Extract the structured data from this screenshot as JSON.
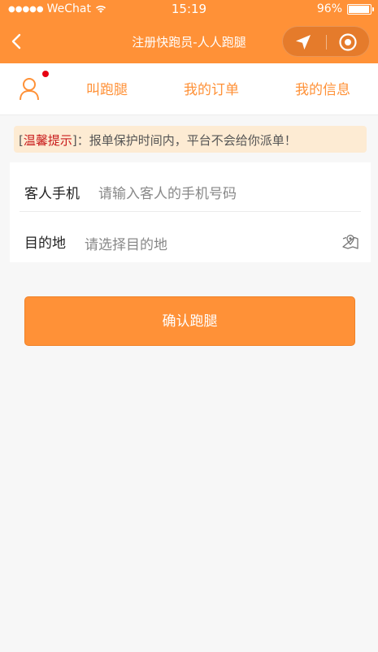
{
  "statusbar": {
    "signal": "●●●●●",
    "carrier": "WeChat",
    "time": "15:19",
    "battery": "96%",
    "battery_level": 0.96
  },
  "navbar": {
    "title": "注册快跑员-人人跑腿",
    "back_icon": "chevron-left-icon",
    "location_icon": "navigation-arrow-icon",
    "close_icon": "target-circle-icon"
  },
  "tabs": {
    "user_icon": "user-icon",
    "items": [
      "叫跑腿",
      "我的订单",
      "我的信息"
    ]
  },
  "notice": {
    "open": "[",
    "label": "温馨提示",
    "close": "]：",
    "text": "报单保护时间内，平台不会给你派单！"
  },
  "form": {
    "phone_label": "客人手机",
    "phone_placeholder": "请输入客人的手机号码",
    "dest_label": "目的地",
    "dest_placeholder": "请选择目的地",
    "dest_icon": "map-pin-icon"
  },
  "confirm_button": "确认跑腿",
  "colors": {
    "accent": "#ff9137",
    "notice_bg": "#fdebd3",
    "notice_label": "#c81b1b",
    "badge": "#e60012"
  }
}
